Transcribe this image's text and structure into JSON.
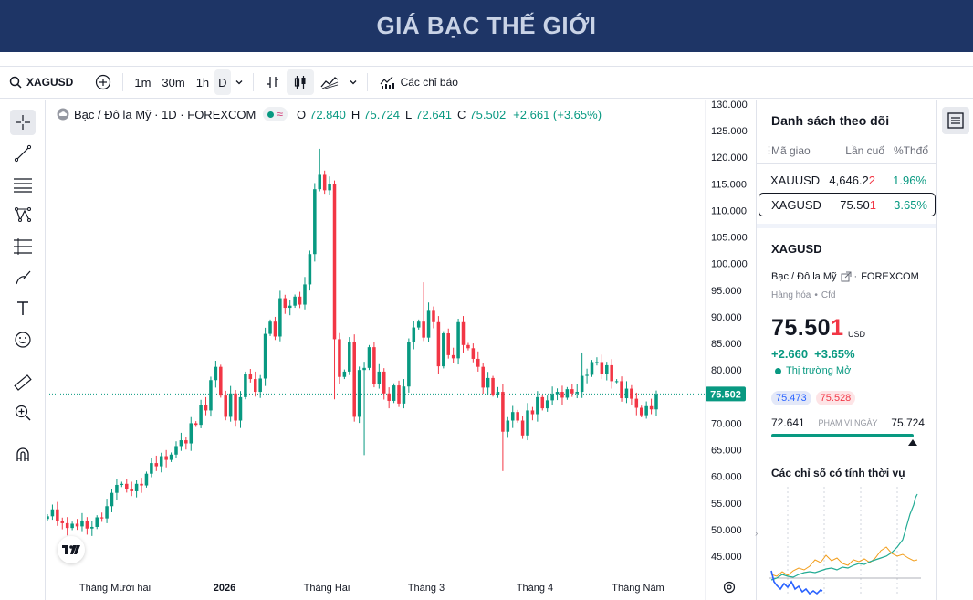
{
  "banner": {
    "title": "GIÁ BẠC THẾ GIỚI"
  },
  "toolbar": {
    "symbol": "XAGUSD",
    "intervals": [
      "1m",
      "30m",
      "1h",
      "D"
    ],
    "indicators_label": "Các chỉ báo"
  },
  "legend": {
    "name": "Bạc / Đô la Mỹ · 1D · FOREXCOM",
    "o_label": "O",
    "o_value": "72.840",
    "h_label": "H",
    "h_value": "75.724",
    "l_label": "L",
    "l_value": "72.641",
    "c_label": "C",
    "c_value": "75.502",
    "change": "+2.661 (+3.65%)"
  },
  "price_axis": {
    "current_price": "75.502"
  },
  "watchlist": {
    "title": "Danh sách theo dõi",
    "headers": [
      "Mã giao",
      "Lần cuố",
      "%Thđổ"
    ],
    "rows": [
      {
        "symbol": "XAUUSD",
        "last": "4,646.22",
        "last_main": "4,646.2",
        "last_tail": "2",
        "change": "1.96%"
      },
      {
        "symbol": "XAGUSD",
        "last": "75.501",
        "last_main": "75.50",
        "last_tail": "1",
        "change": "3.65%"
      }
    ]
  },
  "details": {
    "symbol": "XAGUSD",
    "description": "Bạc / Đô la Mỹ",
    "exchange": "FOREXCOM",
    "category": "Hàng hóa",
    "category_type": "Cfd",
    "price": "75.501",
    "price_main": "75.50",
    "price_tail": "1",
    "currency": "USD",
    "change": "+2.660",
    "change_pct": "+3.65%",
    "market_status": "Thị trường Mở",
    "bid": "75.473",
    "ask": "75.528",
    "range_low": "72.641",
    "range_high": "75.724",
    "range_label": "PHẠM VI NGÀY",
    "seasonal_title": "Các chỉ số có tính thời vụ"
  },
  "colors": {
    "up": "#089981",
    "down": "#f23645",
    "banner": "#1e3566"
  },
  "chart_data": {
    "type": "candlestick",
    "ylim": [
      42,
      130
    ],
    "y_ticks": [
      130,
      125,
      120,
      115,
      110,
      105,
      100,
      95,
      90,
      85,
      80,
      75,
      70,
      65,
      60,
      55,
      50,
      45
    ],
    "x_ticks": [
      "Tháng Mười hai",
      "2026",
      "Tháng Hai",
      "Tháng 3",
      "Tháng 4",
      "Tháng Năm"
    ],
    "current_price": 75.502,
    "closes": [
      52.5,
      53.8,
      51.6,
      51.2,
      50.3,
      51.1,
      50.6,
      51.7,
      50.2,
      50.5,
      52.3,
      52.1,
      54.4,
      56.9,
      58.4,
      58.6,
      57.6,
      57.2,
      58.6,
      58.3,
      60.5,
      62.5,
      61.9,
      63.8,
      63.1,
      64.1,
      65.7,
      66.8,
      66.2,
      70.0,
      69.7,
      73.5,
      72.4,
      78.1,
      80.6,
      75.2,
      71.2,
      75.6,
      70.5,
      74.9,
      79.3,
      78.3,
      75.9,
      78.4,
      86.8,
      89.1,
      86.3,
      93.5,
      91.7,
      92.1,
      93.8,
      92.3,
      96.1,
      101.8,
      114.0,
      116.7,
      113.8,
      115.0,
      85.8,
      78.7,
      79.7,
      85.3,
      71.2,
      80.0,
      80.4,
      84.3,
      77.4,
      79.7,
      75.6,
      74.2,
      77.1,
      73.7,
      76.9,
      85.3,
      88.0,
      89.1,
      86.1,
      91.3,
      89.0,
      80.7,
      86.9,
      82.8,
      82.2,
      89.0,
      84.7,
      84.1,
      82.1,
      80.6,
      76.7,
      78.5,
      75.4,
      75.9,
      68.4,
      70.5,
      72.1,
      70.5,
      67.7,
      72.4,
      71.7,
      74.9,
      72.8,
      74.3,
      75.5,
      75.9,
      74.8,
      76.4,
      75.6,
      75.9,
      78.9,
      79.1,
      81.5,
      81.5,
      79.2,
      80.9,
      77.9,
      77.9,
      74.7,
      76.5,
      74.6,
      72.9,
      71.5,
      73.2,
      72.6,
      75.5
    ]
  }
}
